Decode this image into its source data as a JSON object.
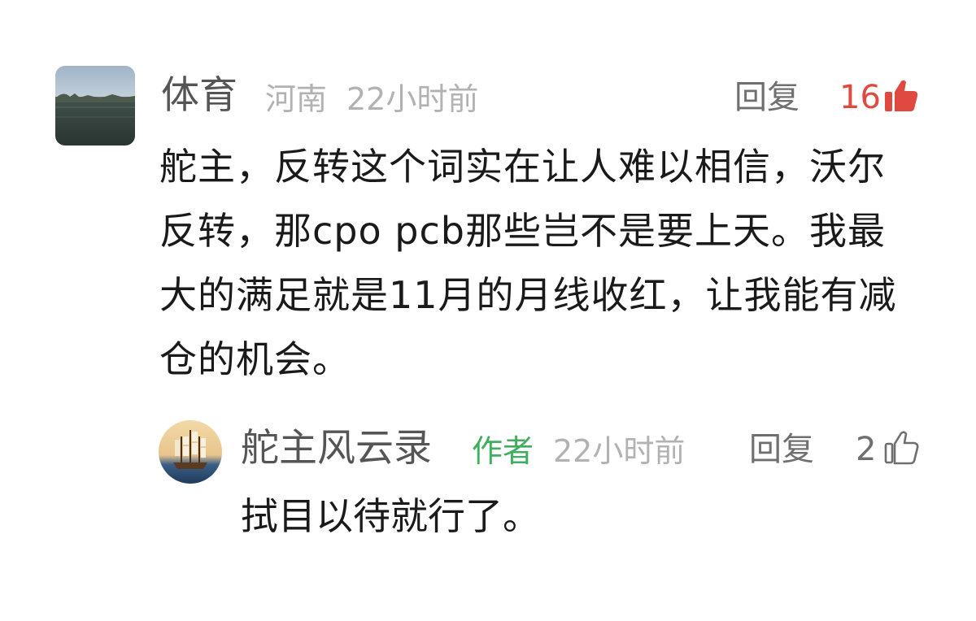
{
  "comment": {
    "username": "体育",
    "location": "河南",
    "time": "22小时前",
    "reply_label": "回复",
    "likes": "16",
    "text": "舵主，反转这个词实在让人难以相信，沃尔反转，那cpo pcb那些岂不是要上天。我最大的满足就是11月的月线收红，让我能有减仓的机会。"
  },
  "reply": {
    "username": "舵主风云录",
    "badge": "作者",
    "time": "22小时前",
    "reply_label": "回复",
    "likes": "2",
    "text": "拭目以待就行了。"
  },
  "colors": {
    "liked": "#e0493f",
    "author_badge": "#3fae5e",
    "meta": "#b2b2b2"
  },
  "icons": {
    "comment_like": "thumbs-up-filled-icon",
    "reply_like": "thumbs-up-outline-icon"
  }
}
